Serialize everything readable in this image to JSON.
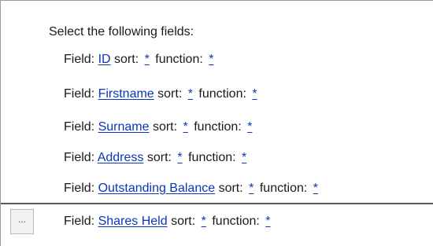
{
  "heading": "Select the following fields:",
  "labels": {
    "field": "Field:",
    "sort": "sort:",
    "function": "function:"
  },
  "fields": [
    {
      "name": "ID",
      "sort": "*",
      "function": "*"
    },
    {
      "name": "Firstname",
      "sort": "*",
      "function": "*"
    },
    {
      "name": "Surname",
      "sort": "*",
      "function": "*"
    },
    {
      "name": "Address",
      "sort": "*",
      "function": "*"
    },
    {
      "name": "Outstanding Balance",
      "sort": "*",
      "function": "*"
    },
    {
      "name": "Shares Held",
      "sort": "*",
      "function": "*"
    }
  ],
  "dots_button": "...",
  "colors": {
    "link": "#0b36b8",
    "separator": "#5a5a5a"
  }
}
